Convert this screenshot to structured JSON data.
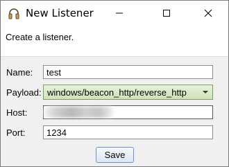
{
  "window": {
    "title": "New Listener"
  },
  "header": {
    "description": "Create a listener."
  },
  "form": {
    "name": {
      "label": "Name:",
      "value": "test"
    },
    "payload": {
      "label": "Payload:",
      "value": "windows/beacon_http/reverse_http"
    },
    "host": {
      "label": "Host:",
      "value": ""
    },
    "port": {
      "label": "Port:",
      "value": "1234"
    }
  },
  "actions": {
    "save_label": "Save"
  },
  "icons": {
    "app": "headphones-icon",
    "minimize": "minimize-icon",
    "maximize": "maximize-icon",
    "close": "close-icon",
    "dropdown": "chevron-down-icon"
  },
  "colors": {
    "combo_bg": "#d6e7c2",
    "button_bg": "#e6edf8"
  }
}
